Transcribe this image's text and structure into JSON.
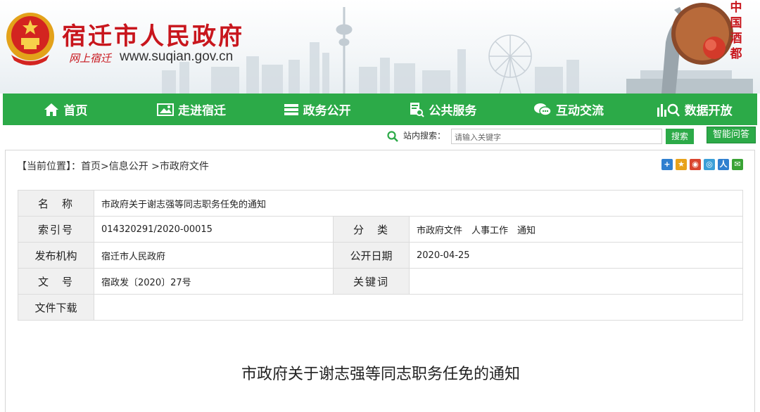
{
  "header": {
    "site_title": "宿迁市人民政府",
    "slogan": "网上宿迁",
    "url": "www.suqian.gov.cn",
    "calligraphy": [
      "中",
      "国",
      "酒",
      "都"
    ]
  },
  "nav": {
    "items": [
      {
        "label": "首页",
        "icon": "home-icon"
      },
      {
        "label": "走进宿迁",
        "icon": "picture-icon"
      },
      {
        "label": "政务公开",
        "icon": "list-icon"
      },
      {
        "label": "公共服务",
        "icon": "document-search-icon"
      },
      {
        "label": "互动交流",
        "icon": "chat-icon"
      },
      {
        "label": "数据开放",
        "icon": "data-search-icon"
      }
    ]
  },
  "search": {
    "label": "站内搜索：",
    "placeholder": "请输入关键字",
    "button": "搜索",
    "qa_button": "智能问答"
  },
  "breadcrumb": "【当前位置】：首页>信息公开 >市政府文件",
  "share_colors": [
    "#2f7fcf",
    "#e8a21a",
    "#d9452f",
    "#3a9fd8",
    "#2f7fcf",
    "#3aa335"
  ],
  "meta": {
    "name_label": "名　称",
    "name_value": "市政府关于谢志强等同志职务任免的通知",
    "index_label": "索引号",
    "index_value": "014320291/2020-00015",
    "category_label": "分　类",
    "category_value": "市政府文件　人事工作　通知",
    "publisher_label": "发布机构",
    "publisher_value": "宿迁市人民政府",
    "date_label": "公开日期",
    "date_value": "2020-04-25",
    "docno_label": "文　号",
    "docno_value": "宿政发〔2020〕27号",
    "keywords_label": "关键词",
    "keywords_value": "",
    "download_label": "文件下载",
    "download_value": ""
  },
  "document": {
    "title": "市政府关于谢志强等同志职务任免的通知"
  },
  "colors": {
    "nav_green": "#2caa48",
    "title_red": "#c8161d"
  }
}
